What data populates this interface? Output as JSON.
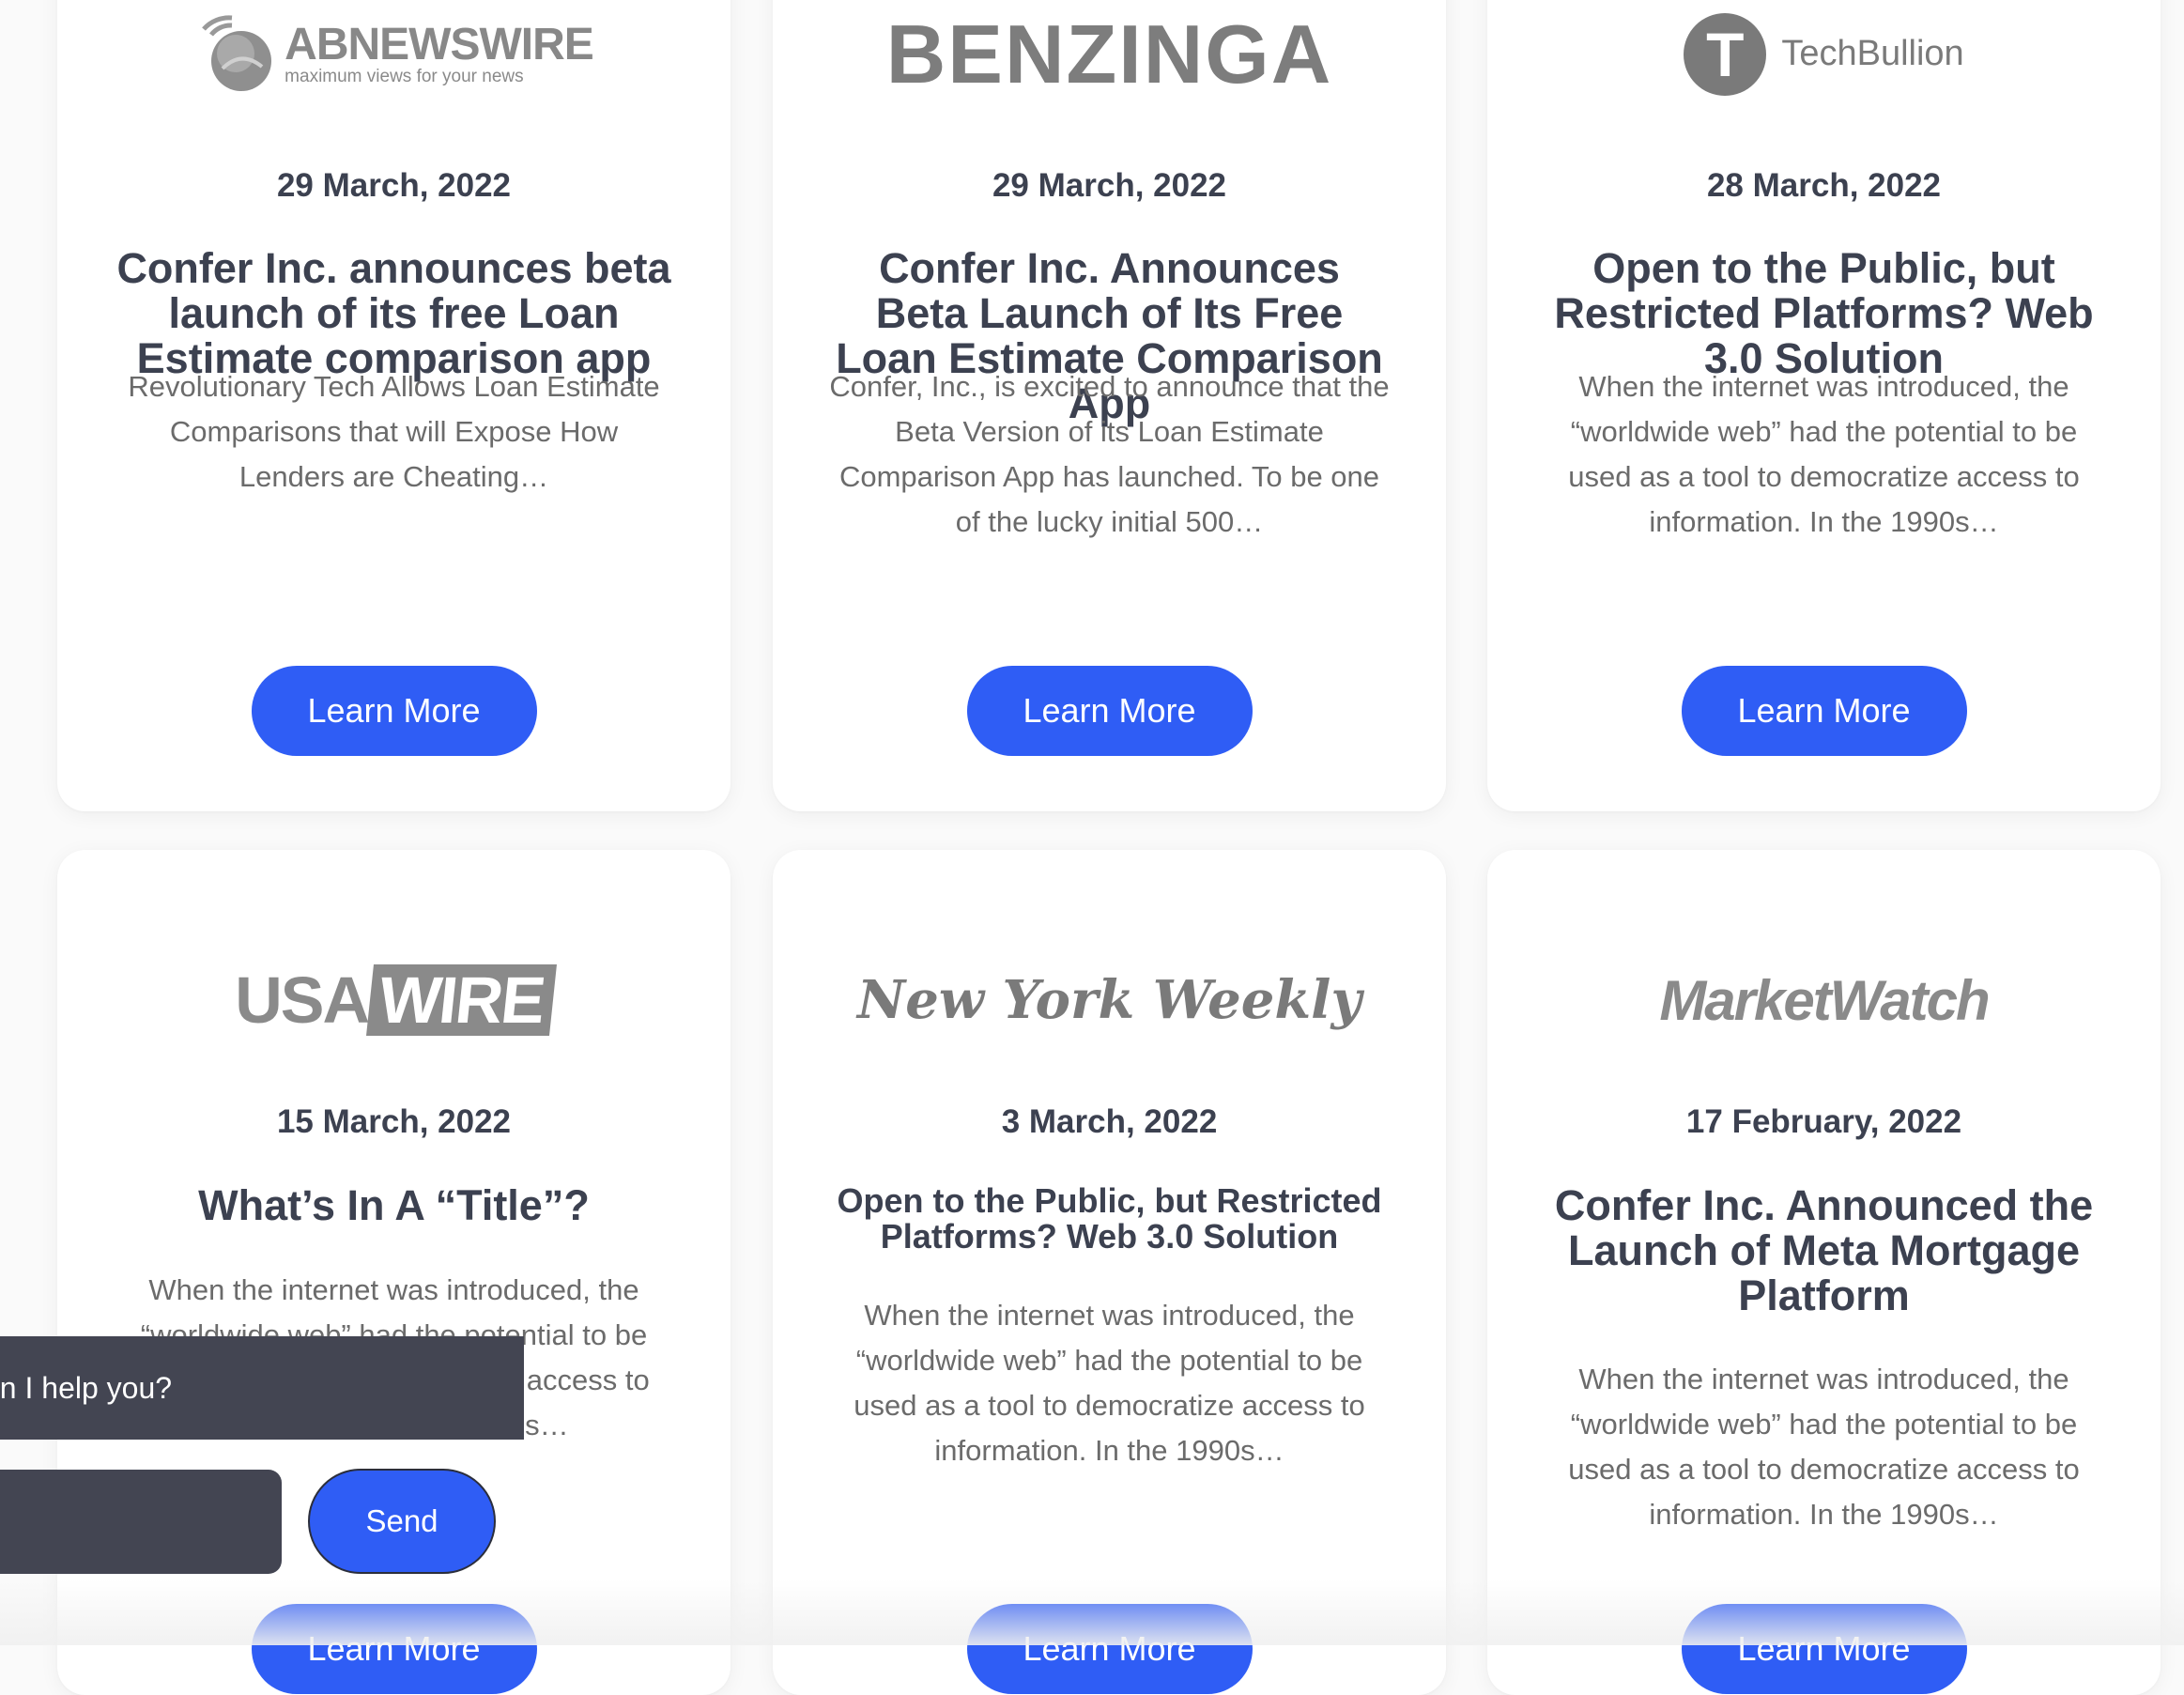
{
  "articles": [
    {
      "logo": {
        "icon": "globe-icon",
        "name": "ABNEWSWIRE",
        "tagline": "maximum views for your news"
      },
      "date": "29 March, 2022",
      "title": "Confer Inc. announces beta launch of its free Loan Estimate comparison app",
      "excerpt": "Revolutionary Tech Allows Loan Estimate Comparisons that will Expose How Lenders are Cheating…",
      "button": "Learn More"
    },
    {
      "logo": {
        "name": "BENZINGA"
      },
      "date": "29 March, 2022",
      "title": "Confer Inc. Announces Beta Launch of Its Free Loan Estimate Comparison App",
      "excerpt": "Confer, Inc., is excited to announce that the Beta Version of its Loan Estimate Comparison App has launched. To be one of the lucky initial 500…",
      "button": "Learn More"
    },
    {
      "logo": {
        "mark": "T",
        "name": "TechBullion"
      },
      "date": "28 March, 2022",
      "title": "Open to the Public, but Restricted Platforms? Web 3.0 Solution",
      "excerpt": "When the internet was introduced, the “worldwide web” had the potential to be used as a tool to democratize access to information. In the 1990s…",
      "button": "Learn More"
    },
    {
      "logo": {
        "part1": "USA",
        "part2": "WIRE"
      },
      "date": "15 March, 2022",
      "title": "What’s In A “Title”?",
      "excerpt": "When the internet was introduced, the “worldwide web” had the potential to be used as a tool to democratize access to information. In the 1990s…",
      "button": "Learn More"
    },
    {
      "logo": {
        "name": "New York Weekly"
      },
      "date": "3 March, 2022",
      "title": "Open to the Public, but Restricted Platforms? Web 3.0 Solution",
      "excerpt": "When the internet was introduced, the “worldwide web” had the potential to be used as a tool to democratize access to information. In the 1990s…",
      "button": "Learn More"
    },
    {
      "logo": {
        "name": "MarketWatch"
      },
      "date": "17 February, 2022",
      "title": "Confer Inc. Announced the Launch of Meta Mortgage Platform",
      "excerpt": "When the internet was introduced, the “worldwide web” had the potential to be used as a tool to democratize access to information. In the 1990s…",
      "button": "Learn More"
    }
  ],
  "chat": {
    "prompt": "an I help you?",
    "send_label": "Send"
  },
  "colors": {
    "accent": "#2f5df5",
    "chat_bg": "#434552",
    "heading": "#3c4150"
  }
}
